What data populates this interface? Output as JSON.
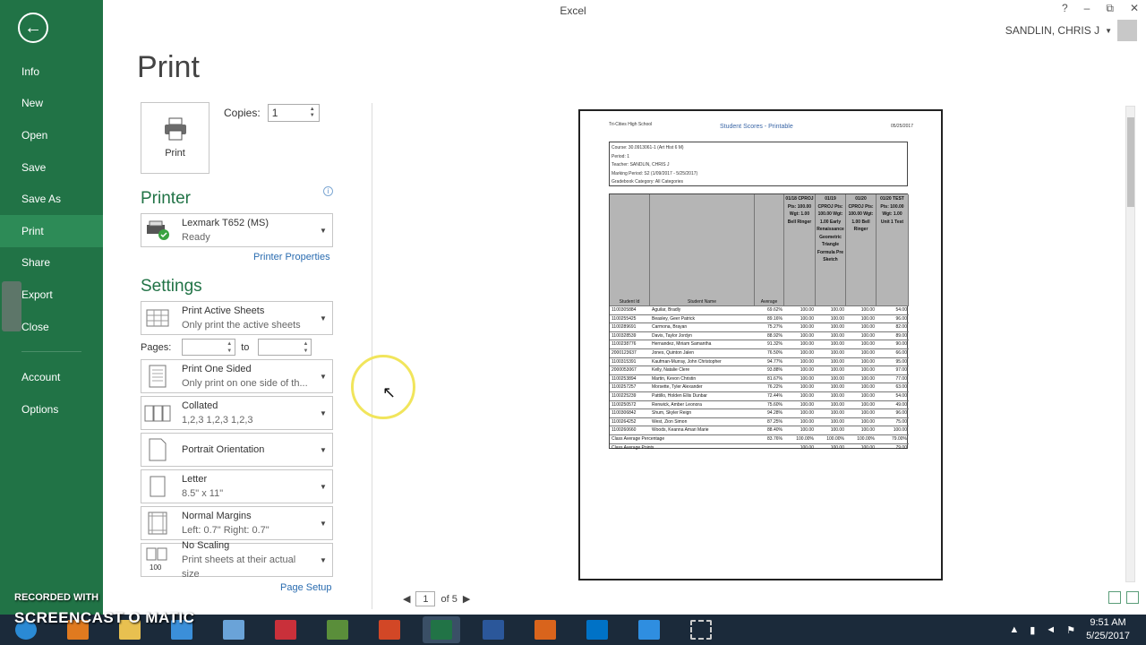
{
  "window": {
    "title": "Excel",
    "controls": [
      "?",
      "–",
      "⧉",
      "✕"
    ],
    "user_name": "SANDLIN, CHRIS J"
  },
  "sidebar": {
    "items": [
      {
        "label": "Info",
        "active": false
      },
      {
        "label": "New",
        "active": false
      },
      {
        "label": "Open",
        "active": false
      },
      {
        "label": "Save",
        "active": false
      },
      {
        "label": "Save As",
        "active": false
      },
      {
        "label": "Print",
        "active": true
      },
      {
        "label": "Share",
        "active": false
      },
      {
        "label": "Export",
        "active": false
      },
      {
        "label": "Close",
        "active": false
      }
    ],
    "bottom_items": [
      "Account",
      "Options"
    ]
  },
  "print": {
    "page_title": "Print",
    "print_button_label": "Print",
    "copies_label": "Copies:",
    "copies_value": "1",
    "printer_heading": "Printer",
    "printer_name": "Lexmark T652 (MS)",
    "printer_status": "Ready",
    "printer_properties": "Printer Properties",
    "settings_heading": "Settings",
    "settings": [
      {
        "line1": "Print Active Sheets",
        "line2": "Only print the active sheets"
      },
      {
        "line1": "Print One Sided",
        "line2": "Only print on one side of th..."
      },
      {
        "line1": "Collated",
        "line2": "1,2,3    1,2,3    1,2,3"
      },
      {
        "line1": "Portrait Orientation",
        "line2": ""
      },
      {
        "line1": "Letter",
        "line2": "8.5\" x 11\""
      },
      {
        "line1": "Normal Margins",
        "line2": "Left:  0.7\"    Right:  0.7\""
      },
      {
        "line1": "No Scaling",
        "line2": "Print sheets at their actual size"
      }
    ],
    "pages_label": "Pages:",
    "pages_to": "to",
    "page_setup": "Page Setup"
  },
  "preview": {
    "school": "Tri-Cities High School",
    "title": "Student Scores - Printable",
    "date": "05/25/2017",
    "info_lines": [
      "Course: 30.0913061-1 (Art Hist 6 M)",
      "Period: 1",
      "Teacher: SANDLIN, CHRIS J",
      "Marking Period: S2 (1/09/2017 - 5/25/2017)",
      "Gradebook Category: All Categories"
    ],
    "columns": [
      "Student Id",
      "Student Name",
      "Average"
    ],
    "assignments": [
      "01/18 CPROJ Pts: 100.00 Wgt: 1.00 Bell Ringer",
      "01/19 CPROJ Pts: 100.00 Wgt: 1.00 Early Renaissance Geometric Triangle Formula Pre Sketch",
      "01/20 CPROJ Pts: 100.00 Wgt: 1.00 Bell Ringer",
      "01/20 TEST Pts: 100.00 Wgt: 1.00 Unit 1 Test"
    ],
    "rows": [
      [
        "1100305884",
        "Aguilar, Bradly",
        "69.62%",
        "100.00",
        "100.00",
        "100.00",
        "54.00"
      ],
      [
        "1100255425",
        "Beasley, Geer Patrick",
        "89.16%",
        "100.00",
        "100.00",
        "100.00",
        "96.00"
      ],
      [
        "1100289691",
        "Carmona, Brayan",
        "75.27%",
        "100.00",
        "100.00",
        "100.00",
        "82.00"
      ],
      [
        "1100328539",
        "Davis, Taylor Jordyn",
        "88.92%",
        "100.00",
        "100.00",
        "100.00",
        "89.00"
      ],
      [
        "1100238776",
        "Hernandez, Miriam Samantha",
        "91.32%",
        "100.00",
        "100.00",
        "100.00",
        "90.00"
      ],
      [
        "2000123637",
        "Jones, Quinton Jalen",
        "76.50%",
        "100.00",
        "100.00",
        "100.00",
        "66.00"
      ],
      [
        "1100315391",
        "Kaufman-Murray, John Christopher",
        "94.77%",
        "100.00",
        "100.00",
        "100.00",
        "95.00"
      ],
      [
        "2000053067",
        "Kelly, Natalie Clere",
        "93.88%",
        "100.00",
        "100.00",
        "100.00",
        "97.00"
      ],
      [
        "1100253894",
        "Martin, Kevon Christin",
        "81.67%",
        "100.00",
        "100.00",
        "100.00",
        "77.00"
      ],
      [
        "1100257257",
        "Morsette, Tyler Alexander",
        "76.22%",
        "100.00",
        "100.00",
        "100.00",
        "63.00"
      ],
      [
        "1100225239",
        "Pattillo, Holden Ellis Dunbar",
        "72.44%",
        "100.00",
        "100.00",
        "100.00",
        "54.00"
      ],
      [
        "1100250572",
        "Renwick, Amber Leonora",
        "75.60%",
        "100.00",
        "100.00",
        "100.00",
        "49.00"
      ],
      [
        "1100306842",
        "Shum, Skyler Reign",
        "94.28%",
        "100.00",
        "100.00",
        "100.00",
        "96.00"
      ],
      [
        "1100264252",
        "West, Zion Simon",
        "87.25%",
        "100.00",
        "100.00",
        "100.00",
        "75.00"
      ],
      [
        "1100260660",
        "Woods, Keanna Amari Marie",
        "88.40%",
        "100.00",
        "100.00",
        "100.00",
        "100.00"
      ],
      [
        "Class Average Percentage",
        "",
        "83.76%",
        "100.00%",
        "100.00%",
        "100.00%",
        "79.00%"
      ],
      [
        "Class Average Points",
        "",
        "",
        "100.00",
        "100.00",
        "100.00",
        "79.00"
      ]
    ]
  },
  "pager": {
    "current": "1",
    "of_label": "of 5"
  },
  "watermark": {
    "line1": "RECORDED WITH",
    "line2": "SCREENCAST O MATIC"
  },
  "taskbar": {
    "time": "9:51 AM",
    "date": "5/25/2017"
  },
  "colors": {
    "accent": "#217346",
    "link": "#2a6cb0"
  }
}
